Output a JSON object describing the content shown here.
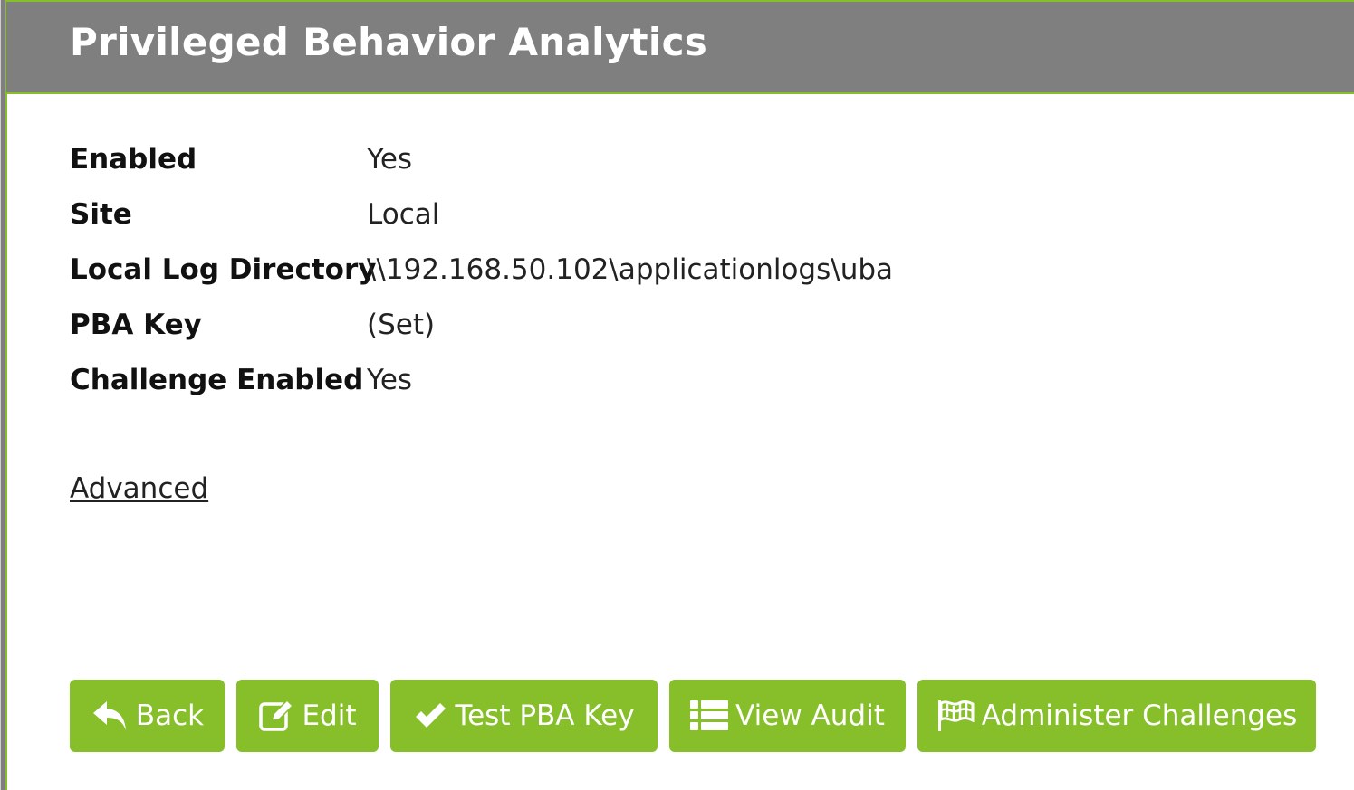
{
  "header": {
    "title": "Privileged Behavior Analytics"
  },
  "details": [
    {
      "label": "Enabled",
      "value": "Yes"
    },
    {
      "label": "Site",
      "value": "Local"
    },
    {
      "label": "Local Log Directory",
      "value": "\\\\192.168.50.102\\applicationlogs\\uba"
    },
    {
      "label": "PBA Key",
      "value": "(Set)"
    },
    {
      "label": "Challenge Enabled",
      "value": "Yes"
    }
  ],
  "advanced_link": "Advanced",
  "buttons": {
    "back": {
      "label": "Back",
      "icon": "reply-arrow-icon"
    },
    "edit": {
      "label": "Edit",
      "icon": "edit-icon"
    },
    "test_key": {
      "label": "Test PBA Key",
      "icon": "check-icon"
    },
    "view_audit": {
      "label": "View Audit",
      "icon": "list-icon"
    },
    "administer_challenges": {
      "label": "Administer Challenges",
      "icon": "flag-icon"
    }
  },
  "colors": {
    "header_bg": "#7f7f7f",
    "accent_green": "#86bf2a",
    "text": "#111111"
  }
}
